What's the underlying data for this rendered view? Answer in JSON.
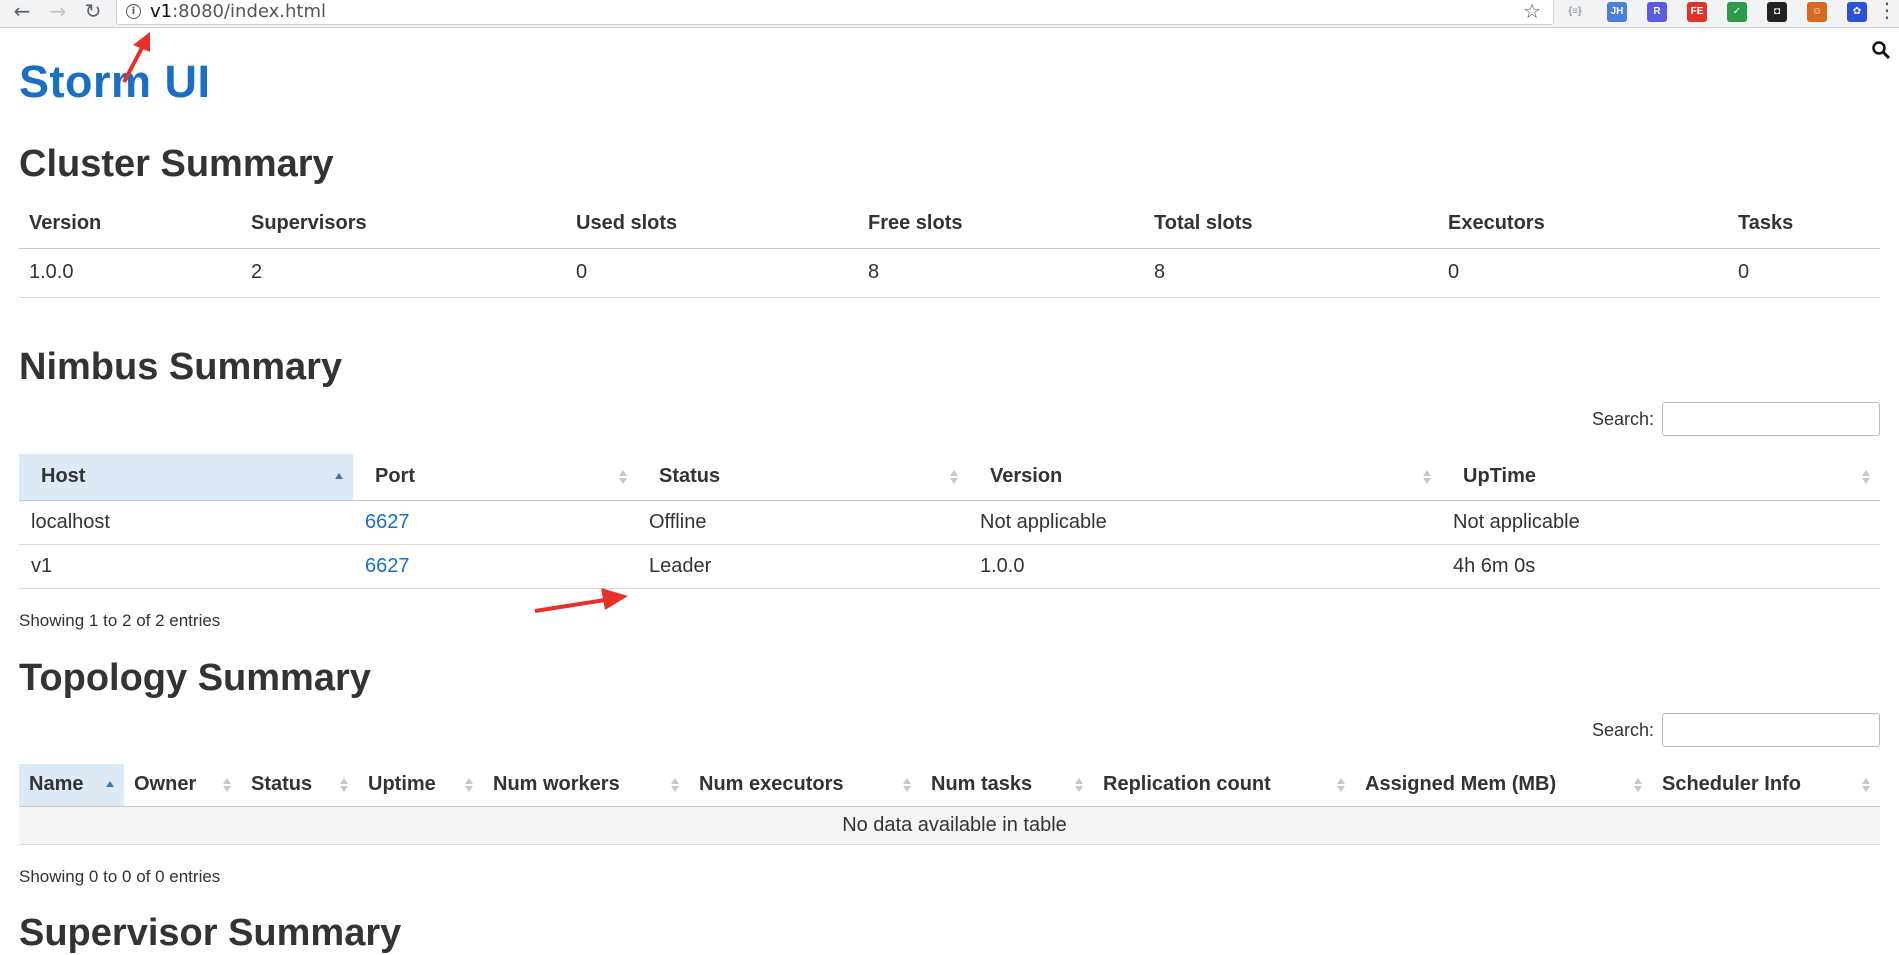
{
  "browser": {
    "url_host": "v1",
    "url_rest": ":8080/index.html",
    "extensions": [
      {
        "name": "json-viewer-icon",
        "label": "{≡}",
        "color": "#9aa0a6"
      },
      {
        "name": "jh-icon",
        "label": "JH",
        "color": "#4a7fdc"
      },
      {
        "name": "r-extension-icon",
        "label": "R",
        "color": "#5a5de0"
      },
      {
        "name": "fe-icon",
        "label": "FE",
        "color": "#e0332a"
      },
      {
        "name": "arrow-extension-icon",
        "label": "✓",
        "color": "#2f9a4a"
      },
      {
        "name": "ghost-icon",
        "label": "◘",
        "color": "#222222"
      },
      {
        "name": "fox-icon",
        "label": "☺",
        "color": "#d9691f"
      },
      {
        "name": "paw-icon",
        "label": "✿",
        "color": "#2f4fd6"
      }
    ]
  },
  "app_title": "Storm UI",
  "cluster": {
    "title": "Cluster Summary",
    "headers": [
      "Version",
      "Supervisors",
      "Used slots",
      "Free slots",
      "Total slots",
      "Executors",
      "Tasks"
    ],
    "row": [
      "1.0.0",
      "2",
      "0",
      "8",
      "8",
      "0",
      "0"
    ]
  },
  "nimbus": {
    "title": "Nimbus Summary",
    "search_label": "Search:",
    "headers": [
      "Host",
      "Port",
      "Status",
      "Version",
      "UpTime"
    ],
    "rows": [
      [
        "localhost",
        "6627",
        "Offline",
        "Not applicable",
        "Not applicable"
      ],
      [
        "v1",
        "6627",
        "Leader",
        "1.0.0",
        "4h 6m 0s"
      ]
    ],
    "info": "Showing 1 to 2 of 2 entries"
  },
  "topology": {
    "title": "Topology Summary",
    "search_label": "Search:",
    "headers": [
      "Name",
      "Owner",
      "Status",
      "Uptime",
      "Num workers",
      "Num executors",
      "Num tasks",
      "Replication count",
      "Assigned Mem (MB)",
      "Scheduler Info"
    ],
    "empty": "No data available in table",
    "info": "Showing 0 to 0 of 0 entries"
  },
  "supervisor": {
    "title": "Supervisor Summary"
  },
  "colors": {
    "brand": "#1a6fc4",
    "link": "#1a6fc4",
    "sorted_header_bg": "#ddeaf5",
    "annotation_arrow": "#e8302a"
  }
}
